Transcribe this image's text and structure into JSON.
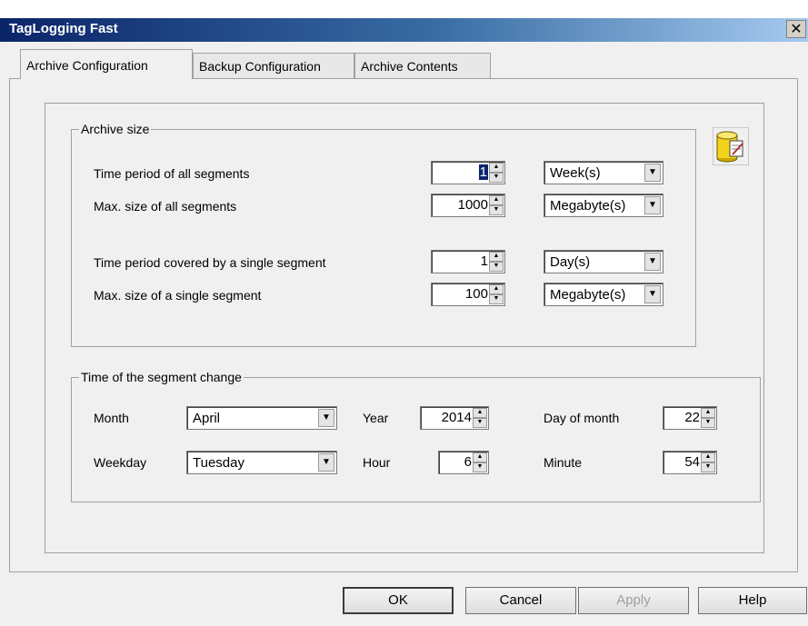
{
  "window": {
    "title": "TagLogging Fast",
    "close_glyph": "✕"
  },
  "tabs": [
    {
      "label": "Archive Configuration",
      "active": true
    },
    {
      "label": "Backup Configuration",
      "active": false
    },
    {
      "label": "Archive Contents",
      "active": false
    }
  ],
  "archive_size": {
    "legend": "Archive size",
    "rows": [
      {
        "label": "Time period of all segments",
        "value": "1",
        "unit": "Week(s)"
      },
      {
        "label": "Max. size of all segments",
        "value": "1000",
        "unit": "Megabyte(s)"
      },
      {
        "label": "Time period covered by a single segment",
        "value": "1",
        "unit": "Day(s)"
      },
      {
        "label": "Max. size of a single segment",
        "value": "100",
        "unit": "Megabyte(s)"
      }
    ]
  },
  "segment_change": {
    "legend": "Time of the segment change",
    "month_label": "Month",
    "month_value": "April",
    "weekday_label": "Weekday",
    "weekday_value": "Tuesday",
    "year_label": "Year",
    "year_value": "2014",
    "hour_label": "Hour",
    "hour_value": "6",
    "day_label": "Day of month",
    "day_value": "22",
    "minute_label": "Minute",
    "minute_value": "54"
  },
  "buttons": {
    "ok": "OK",
    "cancel": "Cancel",
    "apply": "Apply",
    "help": "Help"
  },
  "icons": {
    "database": "database-edit-icon",
    "spin_up": "▲",
    "spin_down": "▼",
    "dropdown": "▼"
  },
  "colors": {
    "title_start": "#0a246a",
    "title_end": "#a6caf0",
    "icon_yellow": "#f2d21b"
  }
}
